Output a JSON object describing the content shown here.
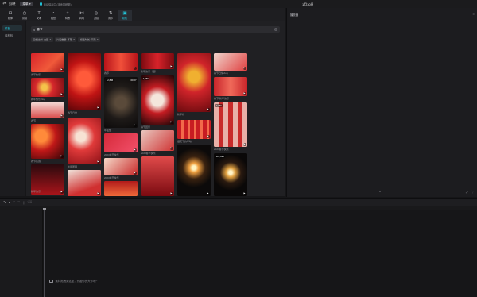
{
  "app": {
    "name": "剪映",
    "menu_label": "菜单",
    "autosave": "自动保存中 (本地草稿箱)",
    "doc_title": "1月30日"
  },
  "toolbar": [
    {
      "label": "媒体",
      "icon": "media-icon"
    },
    {
      "label": "音频",
      "icon": "audio-icon"
    },
    {
      "label": "文本",
      "icon": "text-icon"
    },
    {
      "label": "贴纸",
      "icon": "sticker-icon"
    },
    {
      "label": "特效",
      "icon": "effects-icon"
    },
    {
      "label": "转场",
      "icon": "transition-icon"
    },
    {
      "label": "滤镜",
      "icon": "filter-icon"
    },
    {
      "label": "调节",
      "icon": "adjust-icon"
    },
    {
      "label": "模板",
      "icon": "template-icon",
      "active": true
    }
  ],
  "left_nav": [
    "模板",
    "素材包"
  ],
  "search": {
    "value": "春节",
    "placeholder": "搜索"
  },
  "filters": [
    "画幅比例: 全部",
    "片段数量: 不限",
    "模板时长: 不限"
  ],
  "tiles": [
    {
      "caption": "春节快乐",
      "play": "▶",
      "badge": "",
      "dur": ""
    },
    {
      "caption": "新年快乐Vlog",
      "play": "▶",
      "badge": "",
      "dur": ""
    },
    {
      "caption": "春节",
      "play": "▶",
      "badge": "",
      "dur": ""
    },
    {
      "caption": "春节氛围",
      "play": "▶",
      "badge": "",
      "dur": ""
    },
    {
      "caption": "新年快乐",
      "play": "▶",
      "badge": "",
      "dur": ""
    },
    {
      "caption": "春节日常",
      "play": "▶",
      "badge": "",
      "dur": ""
    },
    {
      "caption": "",
      "play": "▶",
      "badge": "",
      "dur": ""
    },
    {
      "caption": "新年团圆",
      "play": "▶",
      "badge": "",
      "dur": ""
    },
    {
      "caption": "2023春节快乐",
      "play": "▶",
      "badge": "",
      "dur": ""
    },
    {
      "caption": "春节",
      "play": "▶",
      "badge": "",
      "dur": ""
    },
    {
      "caption": "新年快乐",
      "play": "▶",
      "badge": "",
      "dur": ""
    },
    {
      "caption": "2023春节快乐",
      "play": "▶",
      "badge": "",
      "dur": ""
    },
    {
      "caption": "",
      "play": "▶",
      "badge": "",
      "dur": ""
    },
    {
      "caption": "新年祝福",
      "play": "▶",
      "badge": "",
      "dur": ""
    },
    {
      "caption": "春节烟花",
      "play": "▶",
      "badge": "",
      "dur": ""
    },
    {
      "caption": "年夜饭",
      "play": "▶",
      "badge": "12,846",
      "dur": "00:07"
    },
    {
      "caption": "过年啦",
      "play": "▶",
      "badge": "",
      "dur": ""
    },
    {
      "caption": "2023春节快乐",
      "play": "▶",
      "badge": "",
      "dur": ""
    },
    {
      "caption": "",
      "play": "▶",
      "badge": "",
      "dur": ""
    },
    {
      "caption": "新年快乐（烟）",
      "play": "▶",
      "badge": "",
      "dur": ""
    },
    {
      "caption": "春节回家",
      "play": "▶",
      "badge": "",
      "dur": ""
    },
    {
      "caption": "2023春节快乐",
      "play": "▶",
      "badge": "",
      "dur": ""
    },
    {
      "caption": "",
      "play": "▶",
      "badge": "",
      "dur": ""
    },
    {
      "caption": "新年好",
      "play": "▶",
      "badge": "",
      "dur": ""
    },
    {
      "caption": "烟花下的年味",
      "play": "▶",
      "badge": "",
      "dur": ""
    },
    {
      "caption": "",
      "play": "▶",
      "badge": "",
      "dur": ""
    },
    {
      "caption": "春节日常vlog",
      "play": "▶",
      "badge": "",
      "dur": ""
    },
    {
      "caption": "春节·新年快乐",
      "play": "▶",
      "badge": "",
      "dur": ""
    },
    {
      "caption": "新年快乐",
      "play": "▶",
      "badge": "",
      "dur": ""
    },
    {
      "caption": "2023春节快乐",
      "play": "▶",
      "badge": "7,489",
      "dur": ""
    },
    {
      "caption": "",
      "play": "▶",
      "badge": "121,896",
      "dur": ""
    }
  ],
  "player": {
    "title": "播放器",
    "menu": "≡"
  },
  "timeline": {
    "drop_hint": "素材拖拽到这里，开始你的大作吧~"
  }
}
